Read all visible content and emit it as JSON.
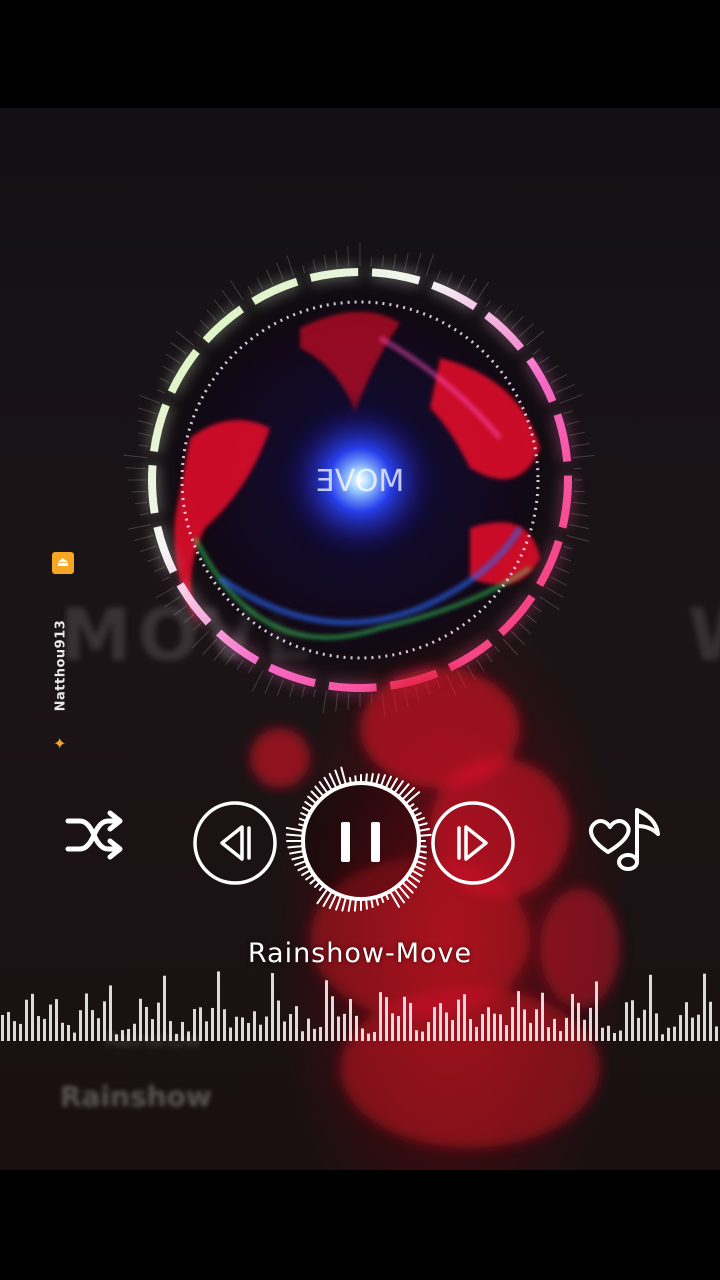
{
  "player": {
    "track_title": "Rainshow-Move",
    "center_logo_text": "MOVE",
    "background_text": "MOVE",
    "shuffle_icon": "shuffle-icon",
    "prev_icon": "skip-previous-icon",
    "pause_icon": "pause-icon",
    "next_icon": "skip-next-icon",
    "favorite_icon": "heart-music-note-icon",
    "state": "playing"
  },
  "watermark": {
    "username": "Natthou913",
    "badge_icon": "app-logo-icon",
    "butterfly_icon": "butterfly-icon"
  },
  "ghost_text": {
    "line1": "Rainshow",
    "line2": "Rainshow"
  },
  "colors": {
    "accent_red": "#e0102a",
    "glow_blue": "#3a6bff",
    "ring_pink": "#ff4fa0",
    "ring_green": "#8cffa0",
    "badge_orange": "#f5a623"
  }
}
